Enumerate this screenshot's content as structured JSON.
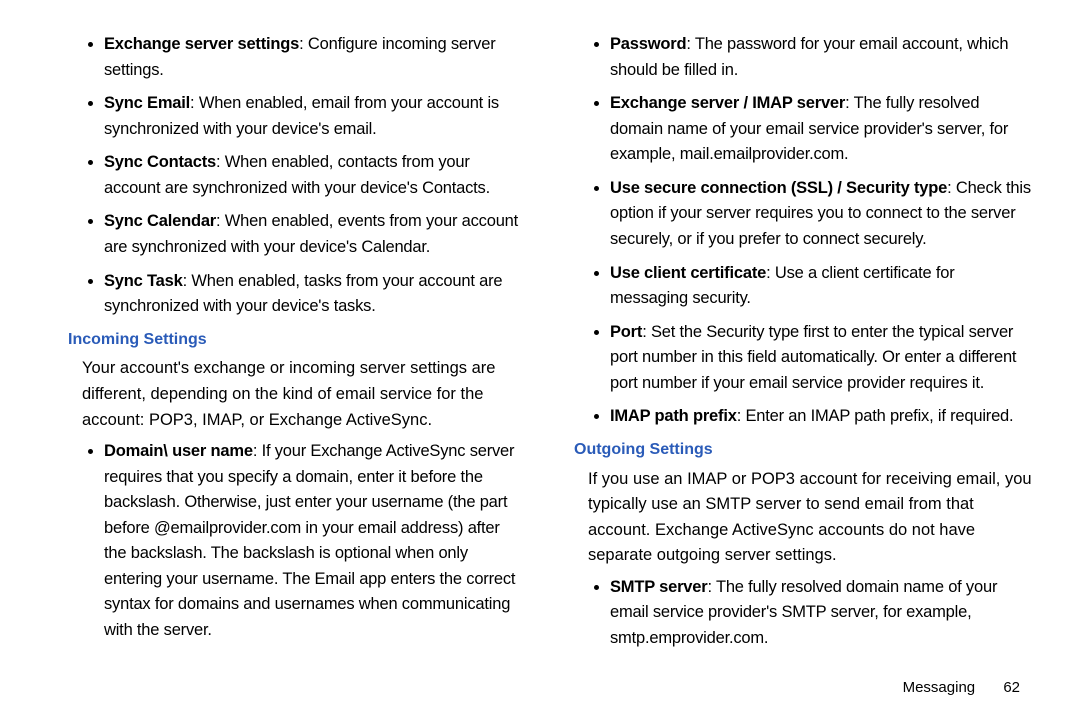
{
  "left": {
    "topBullets": [
      {
        "bold": "Exchange server settings",
        "text": ": Configure incoming server settings."
      },
      {
        "bold": "Sync Email",
        "text": ": When enabled, email from your account is synchronized with your device's email."
      },
      {
        "bold": "Sync Contacts",
        "text": ": When enabled, contacts from your account are synchronized with your device's Contacts."
      },
      {
        "bold": "Sync Calendar",
        "text": ": When enabled, events from your account are synchronized with your device's Calendar."
      },
      {
        "bold": "Sync Task",
        "text": ": When enabled, tasks from your account are synchronized with your device's tasks."
      }
    ],
    "heading": "Incoming Settings",
    "para": "Your account's exchange or incoming server settings are different, depending on the kind of email service for the account: POP3, IMAP, or Exchange ActiveSync.",
    "subBullets": [
      {
        "bold": "Domain\\ user name",
        "text": ": If your Exchange ActiveSync server requires that you specify a domain, enter it before the backslash. Otherwise, just enter your username (the part before @emailprovider.com in your email address) after the backslash. The backslash is optional when only entering your username. The Email app enters the correct syntax for domains and usernames when communicating with the server."
      }
    ]
  },
  "right": {
    "topBullets": [
      {
        "bold": "Password",
        "text": ": The password for your email account, which should be filled in."
      },
      {
        "bold": "Exchange server / IMAP server",
        "text": ": The fully resolved domain name of your email service provider's server, for example, mail.emailprovider.com."
      },
      {
        "bold": "Use secure connection (SSL) / Security type",
        "text": ": Check this option if your server requires you to connect to the server securely, or if you prefer to connect securely."
      },
      {
        "bold": "Use client certificate",
        "text": ": Use a client certificate for messaging security."
      },
      {
        "bold": "Port",
        "text": ": Set the Security type first to enter the typical server port number in this field automatically. Or enter a different port number if your email service provider requires it."
      },
      {
        "bold": "IMAP path prefix",
        "text": ": Enter an IMAP path prefix, if required."
      }
    ],
    "heading": "Outgoing Settings",
    "para": "If you use an IMAP or POP3 account for receiving email, you typically use an SMTP server to send email from that account. Exchange ActiveSync accounts do not have separate outgoing server settings.",
    "subBullets": [
      {
        "bold": "SMTP server",
        "text": ": The fully resolved domain name of your email service provider's SMTP server, for example, smtp.emprovider.com."
      }
    ]
  },
  "footer": {
    "label": "Messaging",
    "page": "62"
  }
}
